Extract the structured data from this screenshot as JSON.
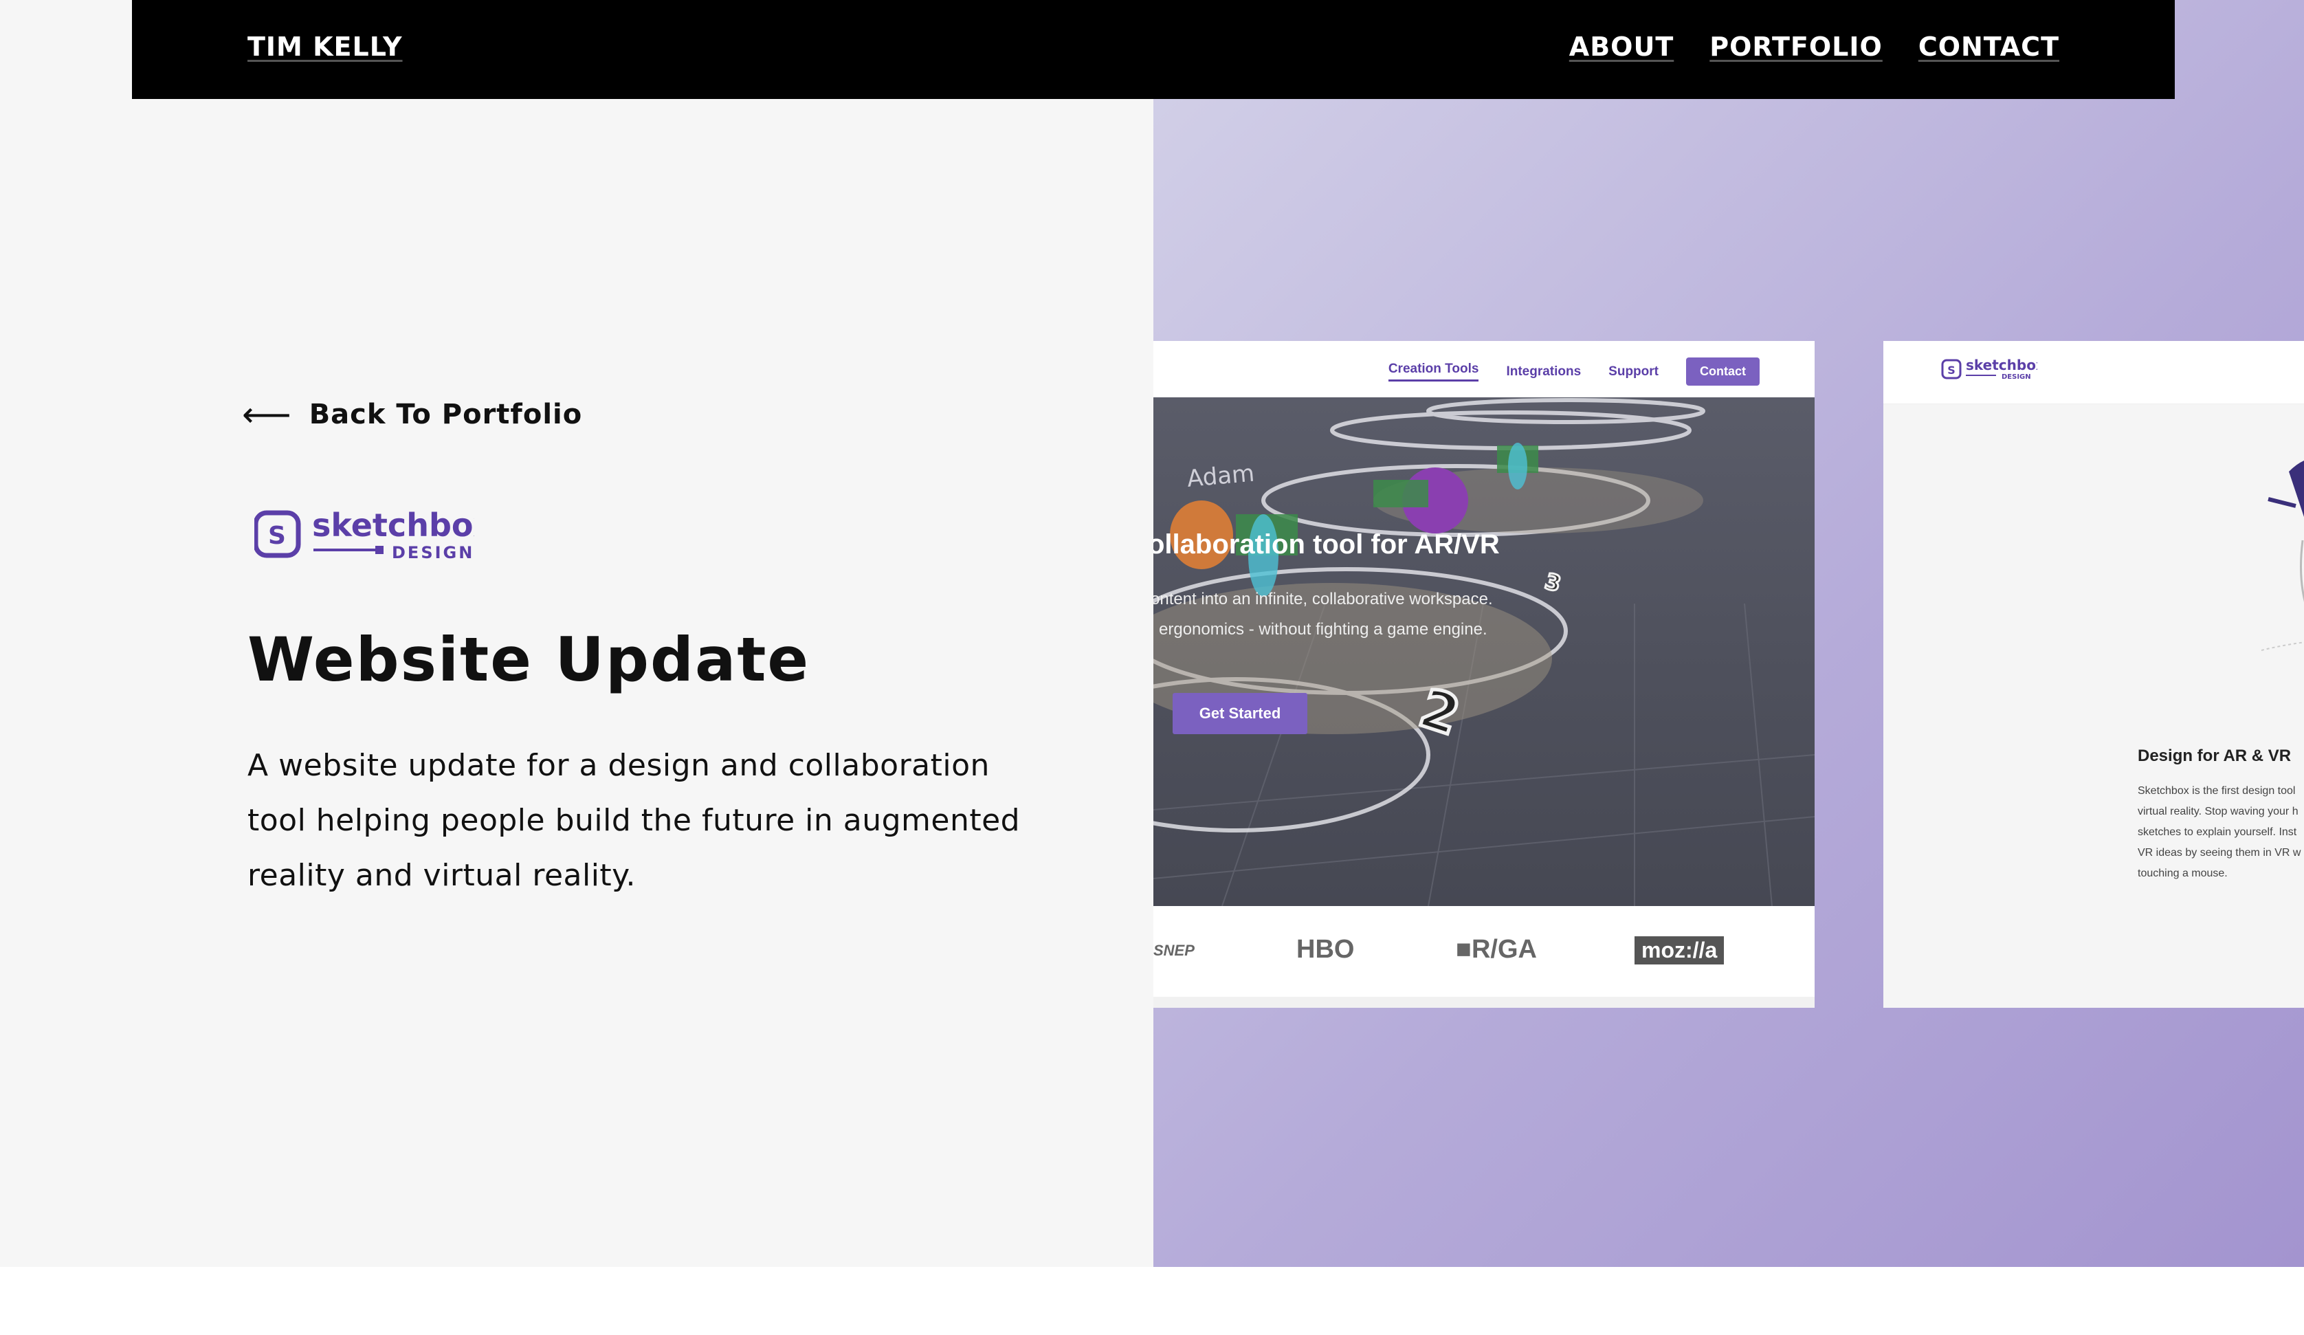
{
  "nav": {
    "brand": "TIM KELLY",
    "items": [
      {
        "label": "ABOUT"
      },
      {
        "label": "PORTFOLIO"
      },
      {
        "label": "CONTACT"
      }
    ]
  },
  "project": {
    "back_label": "Back To Portfolio",
    "logo": {
      "word": "sketchbox",
      "sub": "DESIGN",
      "mark": "S"
    },
    "title": "Website Update",
    "description": "A website update for a design and collaboration tool helping people build the future in augmented reality and virtual reality."
  },
  "screenshot1": {
    "nav": [
      "Creation Tools",
      "Integrations",
      "Support"
    ],
    "contact": "Contact",
    "hero_title": "ollaboration tool for AR/VR",
    "hero_sub": [
      "ontent into an infinite, collaborative workspace.",
      "l ergonomics - without fighting a game engine."
    ],
    "cta": "Get Started",
    "logos": [
      "SNEP",
      "HBO",
      "R/GA",
      "moz://a"
    ],
    "floor_labels": [
      "Adam",
      "2",
      "3"
    ]
  },
  "screenshot2": {
    "logo": {
      "word": "sketchbox",
      "sub": "DESIGN",
      "mark": "S"
    },
    "title": "Design for AR & VR",
    "text": "Sketchbox is the first design tool\nvirtual reality. Stop waving your h\nsketches to explain yourself. Inst\nVR ideas by seeing them in VR w\ntouching a mouse."
  },
  "colors": {
    "accent": "#5b3fa8",
    "button": "#7b61c0",
    "nav_bg": "#000000",
    "left_bg": "#f6f6f6",
    "gradient_start": "#d3d1e8",
    "gradient_end": "#a394cf"
  },
  "icons": {
    "back": "arrow-left-icon"
  }
}
